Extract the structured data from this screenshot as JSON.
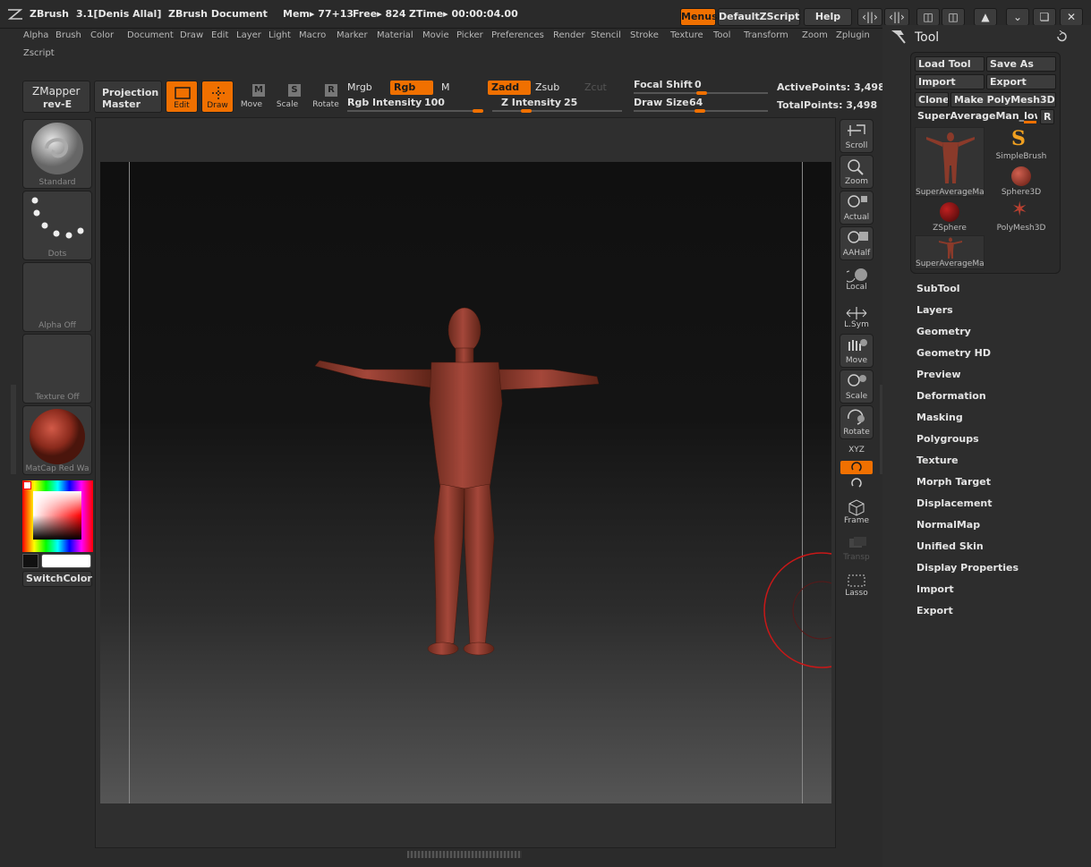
{
  "titlebar": {
    "app": "ZBrush",
    "version": "3.1[Denis Allal]",
    "document": "ZBrush Document",
    "mem": "Mem▸ 77+13",
    "free": "Free▸ 824",
    "ztime": "ZTime▸ 00:00:04.00",
    "menus_btn": "Menus",
    "script_btn": "DefaultZScript",
    "help_btn": "Help"
  },
  "menu": [
    "Alpha",
    "Brush",
    "Color",
    "Document",
    "Draw",
    "Edit",
    "Layer",
    "Light",
    "Macro",
    "Marker",
    "Material",
    "Movie",
    "Picker",
    "Preferences",
    "Render",
    "Stencil",
    "Stroke",
    "Texture",
    "Tool",
    "Transform",
    "Zoom",
    "Zplugin",
    "Zscript"
  ],
  "top_shelf": {
    "zmapper": "ZMapper",
    "zmapper_sub": "rev-E",
    "projection": "Projection",
    "projection_sub": "Master",
    "edit": "Edit",
    "draw": "Draw",
    "move": "Move",
    "scale": "Scale",
    "rotate": "Rotate",
    "mrgb": "Mrgb",
    "rgb": "Rgb",
    "m": "M",
    "rgb_intensity_label": "Rgb  Intensity",
    "rgb_intensity": "100",
    "zadd": "Zadd",
    "zsub": "Zsub",
    "zcut": "Zcut",
    "z_intensity_label": "Z  Intensity",
    "z_intensity": "25",
    "focal_shift_label": "Focal  Shift",
    "focal_shift": "0",
    "draw_size_label": "Draw  Size",
    "draw_size": "64",
    "active_points": "ActivePoints: 3,498",
    "total_points": "TotalPoints: 3,498"
  },
  "left_shelf": {
    "brush": "Standard",
    "stroke": "Dots",
    "alpha": "Alpha  Off",
    "texture": "Texture  Off",
    "material": "MatCap  Red  Wa",
    "switch_color": "SwitchColor"
  },
  "right_shelf": [
    "Scroll",
    "Zoom",
    "Actual",
    "AAHalf",
    "Local",
    "L.Sym",
    "Move",
    "Scale",
    "Rotate",
    "XYZ",
    "",
    "",
    "Frame",
    "Transp",
    "Lasso"
  ],
  "tool_panel": {
    "title": "Tool",
    "load_tool": "Load  Tool",
    "save_as": "Save  As",
    "import": "Import",
    "export": "Export",
    "clone": "Clone",
    "make_polymesh": "Make  PolyMesh3D",
    "current_tool": "SuperAverageMan_low",
    "r_btn": "R",
    "tools": [
      "SuperAverageMa",
      "SimpleBrush",
      "Sphere3D",
      "ZSphere",
      "PolyMesh3D",
      "SuperAverageMa"
    ],
    "sections": [
      "SubTool",
      "Layers",
      "Geometry",
      "Geometry HD",
      "Preview",
      "Deformation",
      "Masking",
      "Polygroups",
      "Texture",
      "Morph Target",
      "Displacement",
      "NormalMap",
      "Unified Skin",
      "Display Properties",
      "Import",
      "Export"
    ]
  },
  "colors": {
    "accent": "#f07000",
    "bg": "#2b2b2b",
    "model": "#8a3a2a"
  }
}
